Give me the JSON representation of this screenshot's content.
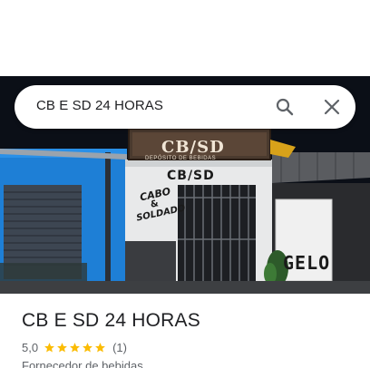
{
  "search": {
    "query": "CB E SD 24 HORAS",
    "search_icon": "search-icon",
    "close_icon": "close-icon"
  },
  "photo": {
    "sign_main": "CB/SD",
    "sign_sub": "DEPÓSITO DE BEBIDAS",
    "wall_sign": "CB/SD",
    "graffiti_1": "CABO",
    "graffiti_2": "&",
    "graffiti_3": "SOLDADO",
    "side_wall_text": "GELO"
  },
  "place": {
    "title": "CB E SD 24 HORAS",
    "rating": "5,0",
    "stars": 5,
    "review_count": "(1)",
    "category": "Fornecedor de bebidas"
  },
  "colors": {
    "star": "#fbbc04",
    "text_primary": "#202124",
    "text_secondary": "#5f6368",
    "blue_wall": "#1e7fd6"
  }
}
